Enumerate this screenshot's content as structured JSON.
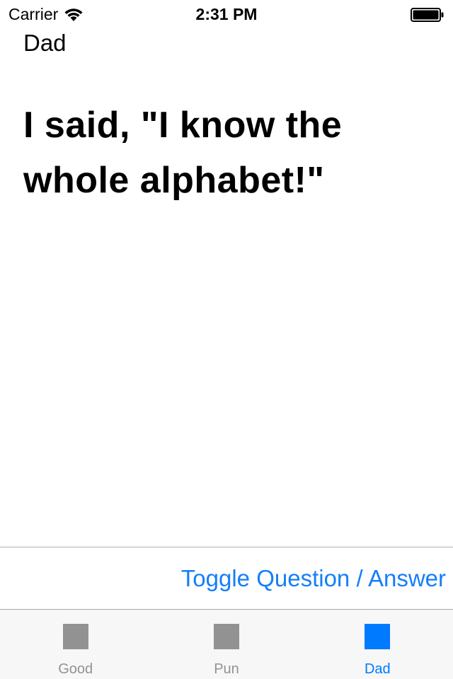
{
  "status_bar": {
    "carrier": "Carrier",
    "time": "2:31 PM",
    "icons": [
      "wifi-icon",
      "battery-icon"
    ]
  },
  "category": {
    "title": "Dad"
  },
  "joke": {
    "text": "I said, \"I know the whole alphabet!\""
  },
  "toolbar": {
    "toggle_label": "Toggle Question / Answer"
  },
  "tab_bar": {
    "items": [
      {
        "label": "Good",
        "icon": "square-icon",
        "selected": false
      },
      {
        "label": "Pun",
        "icon": "square-icon",
        "selected": false
      },
      {
        "label": "Dad",
        "icon": "square-icon",
        "selected": true
      }
    ]
  },
  "colors": {
    "accent": "#007aff",
    "inactive": "#929292",
    "tab_bar_bg": "#f7f7f7"
  }
}
